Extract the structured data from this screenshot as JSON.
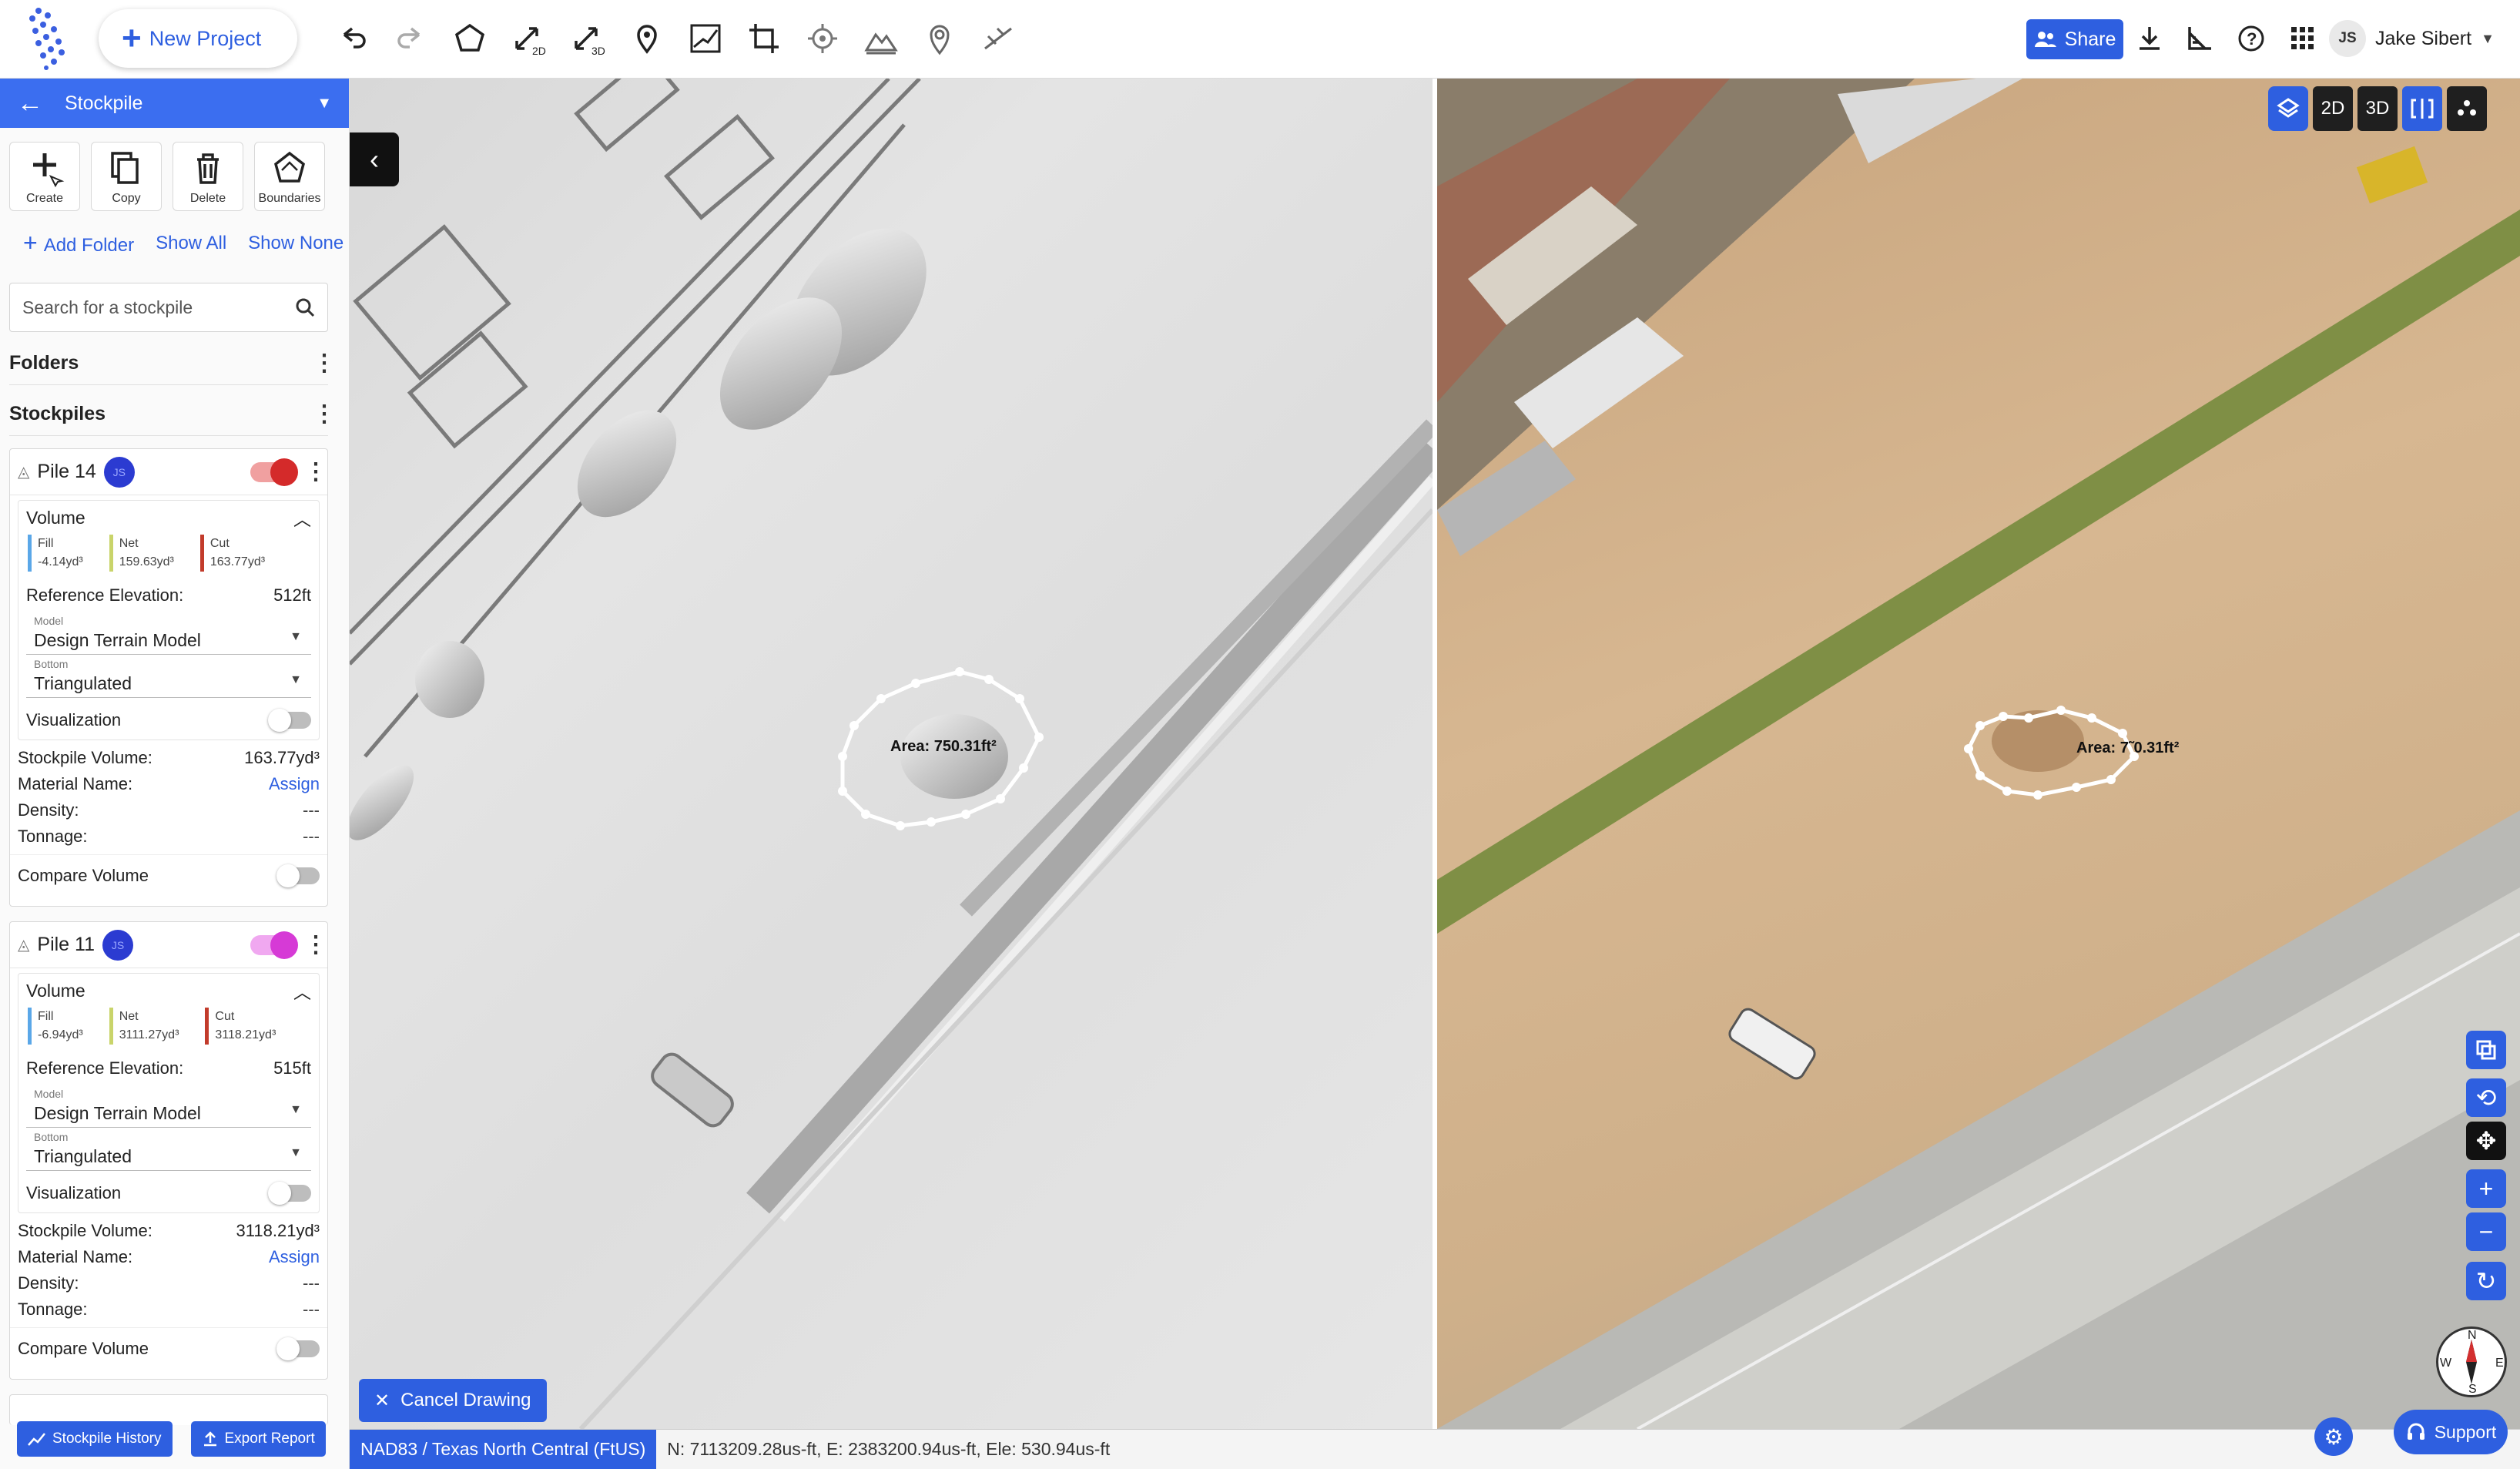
{
  "toolbar": {
    "new_project": "New Project",
    "share": "Share",
    "user_initials": "JS",
    "user_name": "Jake Sibert"
  },
  "panel": {
    "title": "Stockpile",
    "actions": [
      {
        "label": "Create",
        "icon": "create-icon"
      },
      {
        "label": "Copy",
        "icon": "copy-icon"
      },
      {
        "label": "Delete",
        "icon": "delete-icon"
      },
      {
        "label": "Boundaries",
        "icon": "boundaries-icon"
      }
    ],
    "add_folder": "Add Folder",
    "show_all": "Show All",
    "show_none": "Show None",
    "search_placeholder": "Search for a stockpile",
    "folders_label": "Folders",
    "stockpiles_label": "Stockpiles",
    "piles": [
      {
        "name": "Pile 14",
        "initials": "JS",
        "toggle_color": "#d42a2a",
        "toggle_track": "#f0a0a0",
        "volume_label": "Volume",
        "fill_label": "Fill",
        "fill": "-4.14yd³",
        "net_label": "Net",
        "net": "159.63yd³",
        "cut_label": "Cut",
        "cut": "163.77yd³",
        "ref_elev_label": "Reference Elevation:",
        "ref_elev": "512ft",
        "model_label": "Model",
        "model": "Design Terrain Model",
        "bottom_label": "Bottom",
        "bottom": "Triangulated",
        "visualization": "Visualization",
        "stockpile_volume_label": "Stockpile Volume:",
        "stockpile_volume": "163.77yd³",
        "material_label": "Material Name:",
        "material": "Assign",
        "density_label": "Density:",
        "density": "---",
        "tonnage_label": "Tonnage:",
        "tonnage": "---",
        "compare": "Compare Volume"
      },
      {
        "name": "Pile 11",
        "initials": "JS",
        "toggle_color": "#d63ad6",
        "toggle_track": "#f0a8f0",
        "volume_label": "Volume",
        "fill_label": "Fill",
        "fill": "-6.94yd³",
        "net_label": "Net",
        "net": "3111.27yd³",
        "cut_label": "Cut",
        "cut": "3118.21yd³",
        "ref_elev_label": "Reference Elevation:",
        "ref_elev": "515ft",
        "model_label": "Model",
        "model": "Design Terrain Model",
        "bottom_label": "Bottom",
        "bottom": "Triangulated",
        "visualization": "Visualization",
        "stockpile_volume_label": "Stockpile Volume:",
        "stockpile_volume": "3118.21yd³",
        "material_label": "Material Name:",
        "material": "Assign",
        "density_label": "Density:",
        "density": "---",
        "tonnage_label": "Tonnage:",
        "tonnage": "---",
        "compare": "Compare Volume"
      }
    ],
    "stockpile_history": "Stockpile History",
    "export_report": "Export Report"
  },
  "map": {
    "view_2d": "2D",
    "view_3d": "3D",
    "area_left": "Area: 750.31ft²",
    "area_right": "Area: 7˜0.31ft²",
    "cancel_drawing": "Cancel Drawing",
    "crs": "NAD83 / Texas North Central (FtUS)",
    "coordinates": "N: 7113209.28us-ft, E: 2383200.94us-ft, Ele: 530.94us-ft",
    "support": "Support",
    "compass_n": "N",
    "compass_s": "S",
    "compass_e": "E",
    "compass_w": "W"
  }
}
